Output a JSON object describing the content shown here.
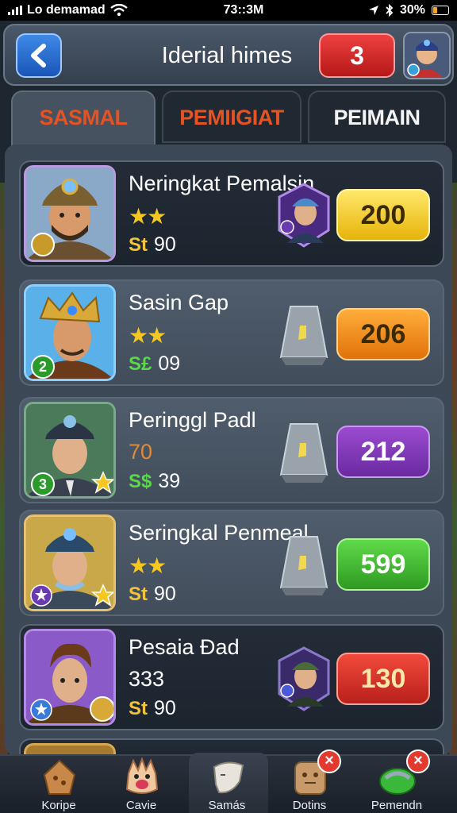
{
  "status_bar": {
    "carrier": "Lo demamad",
    "time": "73::3M",
    "battery": "30%",
    "battery_level": 0.3
  },
  "header": {
    "title": "Iderial himes",
    "count": "3"
  },
  "tabs": [
    {
      "label": "SASMAL",
      "active": true
    },
    {
      "label": "PEMIIGIAT",
      "active": false
    },
    {
      "label": "PEIMAIN",
      "active": false
    }
  ],
  "cards": [
    {
      "name": "Neringkat Pemalsin",
      "stars": "★★",
      "sub": "",
      "currency": "St",
      "price": "90",
      "value": "200",
      "value_color": "yellow",
      "slot": "hero-badge",
      "level": ""
    },
    {
      "name": "Sasin Gap",
      "stars": "★★",
      "sub": "",
      "currency": "S£",
      "price": "09",
      "value": "206",
      "value_color": "orange",
      "slot": "stone",
      "level": "2"
    },
    {
      "name": "Peringgl Padl",
      "stars": "",
      "sub": "70",
      "currency": "S$",
      "price": "39",
      "value": "212",
      "value_color": "purple",
      "slot": "stone",
      "level": "3"
    },
    {
      "name": "Seringkal Penmeal",
      "stars": "★★",
      "sub": "",
      "currency": "St",
      "price": "90",
      "value": "599",
      "value_color": "green",
      "slot": "stone",
      "level": ""
    },
    {
      "name": "Pesaia Ðad",
      "stars": "",
      "sub": "333",
      "currency": "St",
      "price": "90",
      "value": "130",
      "value_color": "red",
      "slot": "hero-badge",
      "level": ""
    }
  ],
  "bottom_nav": [
    {
      "label": "Koripe",
      "icon": "star-cookie-icon"
    },
    {
      "label": "Cavie",
      "icon": "monster-icon"
    },
    {
      "label": "Samás",
      "icon": "ghost-icon",
      "active": true
    },
    {
      "label": "Dotins",
      "icon": "crate-icon",
      "badge": "×"
    },
    {
      "label": "Pemendn",
      "icon": "controller-icon",
      "badge": "×"
    }
  ]
}
